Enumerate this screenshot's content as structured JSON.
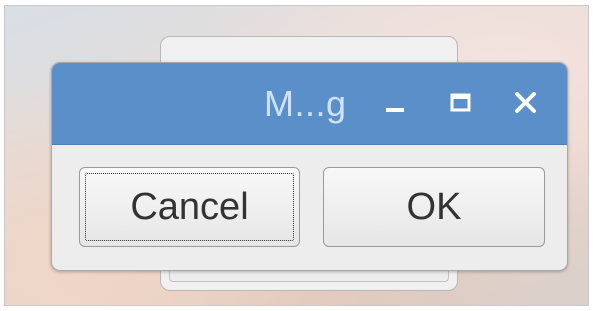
{
  "dialog": {
    "title": "M...g",
    "controls": {
      "minimize_icon": "minimize-icon",
      "maximize_icon": "maximize-icon",
      "close_icon": "close-icon"
    },
    "buttons": {
      "cancel_label": "Cancel",
      "ok_label": "OK"
    }
  },
  "colors": {
    "titlebar": "#5b8fca",
    "title_text": "#cfe1f4",
    "dialog_bg": "#ededed"
  }
}
